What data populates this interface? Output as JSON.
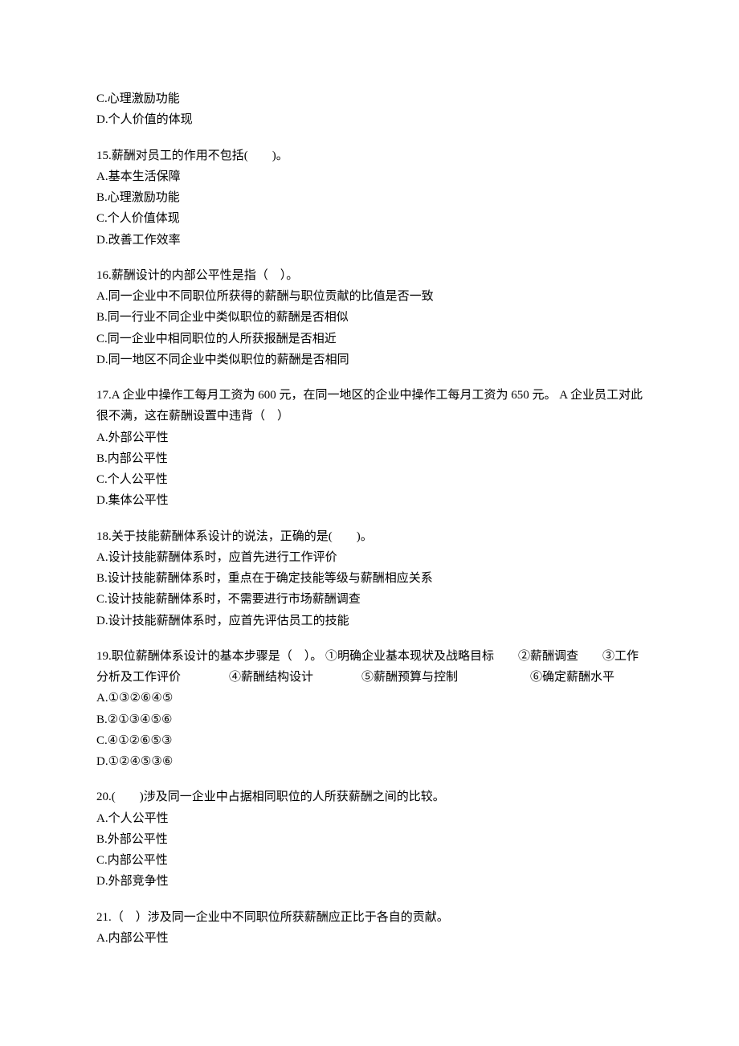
{
  "orphanOptions": [
    "C.心理激励功能",
    "D.个人价值的体现"
  ],
  "questions": [
    {
      "stem": "15.薪酬对员工的作用不包括(　　)。",
      "options": [
        "A.基本生活保障",
        "B.心理激励功能",
        "C.个人价值体现",
        "D.改善工作效率"
      ]
    },
    {
      "stem": "16.薪酬设计的内部公平性是指（　）。",
      "options": [
        "A.同一企业中不同职位所获得的薪酬与职位贡献的比值是否一致",
        "B.同一行业不同企业中类似职位的薪酬是否相似",
        "C.同一企业中相同职位的人所获报酬是否相近",
        "D.同一地区不同企业中类似职位的薪酬是否相同"
      ]
    },
    {
      "stem": "17.A 企业中操作工每月工资为 600 元，在同一地区的企业中操作工每月工资为 650 元。 A 企业员工对此很不满，这在薪酬设置中违背（　）",
      "options": [
        "A.外部公平性",
        "B.内部公平性",
        "C.个人公平性",
        "D.集体公平性"
      ]
    },
    {
      "stem": "18.关于技能薪酬体系设计的说法，正确的是(　　)。",
      "options": [
        "A.设计技能薪酬体系时，应首先进行工作评价",
        "B.设计技能薪酬体系时，重点在于确定技能等级与薪酬相应关系",
        "C.设计技能薪酬体系时，不需要进行市场薪酬调查",
        "D.设计技能薪酬体系时，应首先评估员工的技能"
      ]
    },
    {
      "stem": "19.职位薪酬体系设计的基本步骤是（　）。 ①明确企业基本现状及战略目标　　②薪酬调查　　③工作分析及工作评价　　　　④薪酬结构设计　　　　⑤薪酬预算与控制　　　　　　⑥确定薪酬水平",
      "options": [
        "A.①③②⑥④⑤",
        "B.②①③④⑤⑥",
        "C.④①②⑥⑤③",
        "D.①②④⑤③⑥"
      ]
    },
    {
      "stem": "20.(　　)涉及同一企业中占据相同职位的人所获薪酬之间的比较。",
      "options": [
        "A.个人公平性",
        "B.外部公平性",
        "C.内部公平性",
        "D.外部竞争性"
      ]
    },
    {
      "stem": "21.（　）涉及同一企业中不同职位所获薪酬应正比于各自的贡献。",
      "options": [
        "A.内部公平性"
      ]
    }
  ]
}
